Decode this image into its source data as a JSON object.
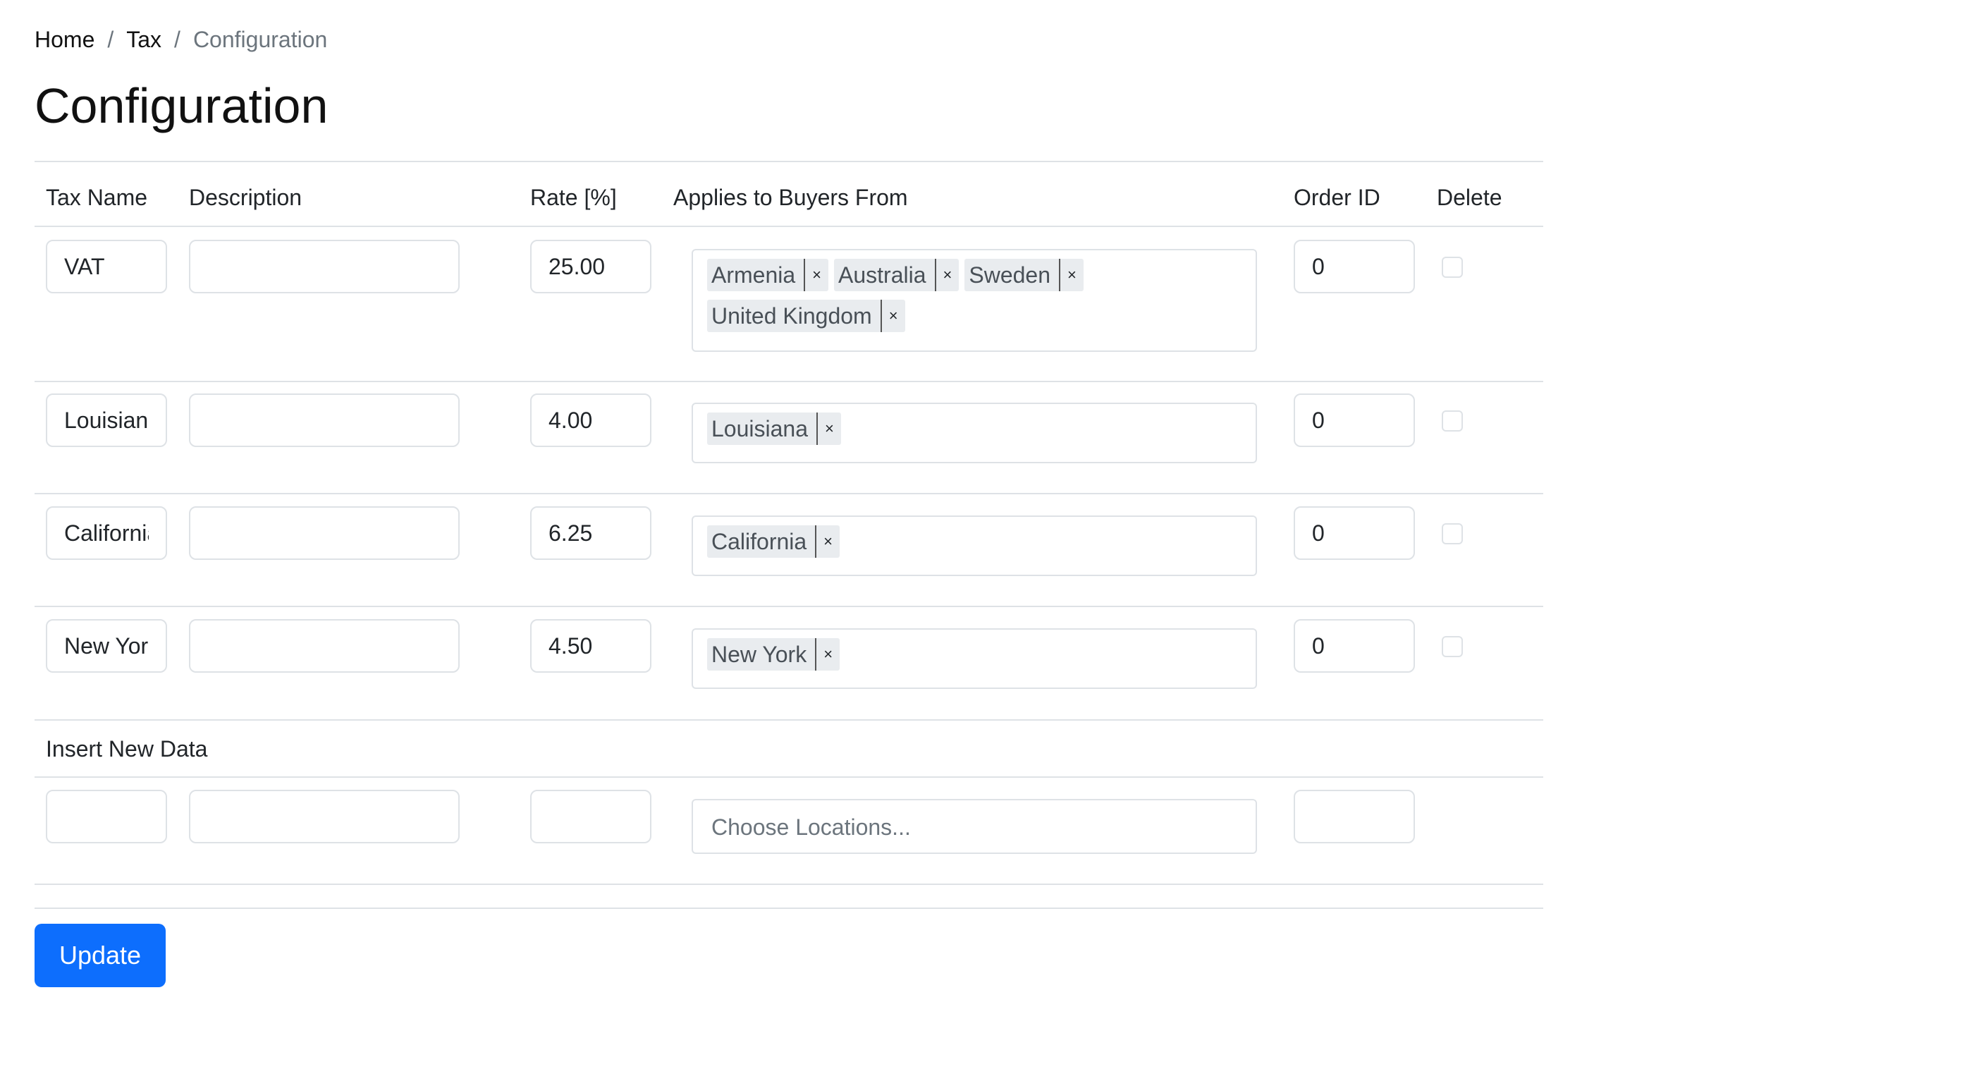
{
  "breadcrumb": {
    "items": [
      "Home",
      "Tax",
      "Configuration"
    ],
    "separator": "/"
  },
  "page_title": "Configuration",
  "table": {
    "headers": {
      "tax_name": "Tax Name",
      "description": "Description",
      "rate": "Rate [%]",
      "applies_to": "Applies to Buyers From",
      "order_id": "Order ID",
      "delete": "Delete"
    },
    "rows": [
      {
        "name": "VAT",
        "description": "",
        "rate": "25.00",
        "locations": [
          "Armenia",
          "Australia",
          "Sweden",
          "United Kingdom"
        ],
        "order_id": "0",
        "delete": false
      },
      {
        "name": "Louisiana",
        "description": "",
        "rate": "4.00",
        "locations": [
          "Louisiana"
        ],
        "order_id": "0",
        "delete": false
      },
      {
        "name": "California",
        "description": "",
        "rate": "6.25",
        "locations": [
          "California"
        ],
        "order_id": "0",
        "delete": false
      },
      {
        "name": "New York",
        "description": "",
        "rate": "4.50",
        "locations": [
          "New York"
        ],
        "order_id": "0",
        "delete": false
      }
    ],
    "tag_remove_glyph": "×"
  },
  "insert_section": {
    "label": "Insert New Data",
    "locations_placeholder": "Choose Locations..."
  },
  "update_button_label": "Update",
  "colors": {
    "primary": "#0d6efd",
    "border": "#dee2e6",
    "tag_bg": "#e9ecef",
    "muted_text": "#6c757d"
  }
}
